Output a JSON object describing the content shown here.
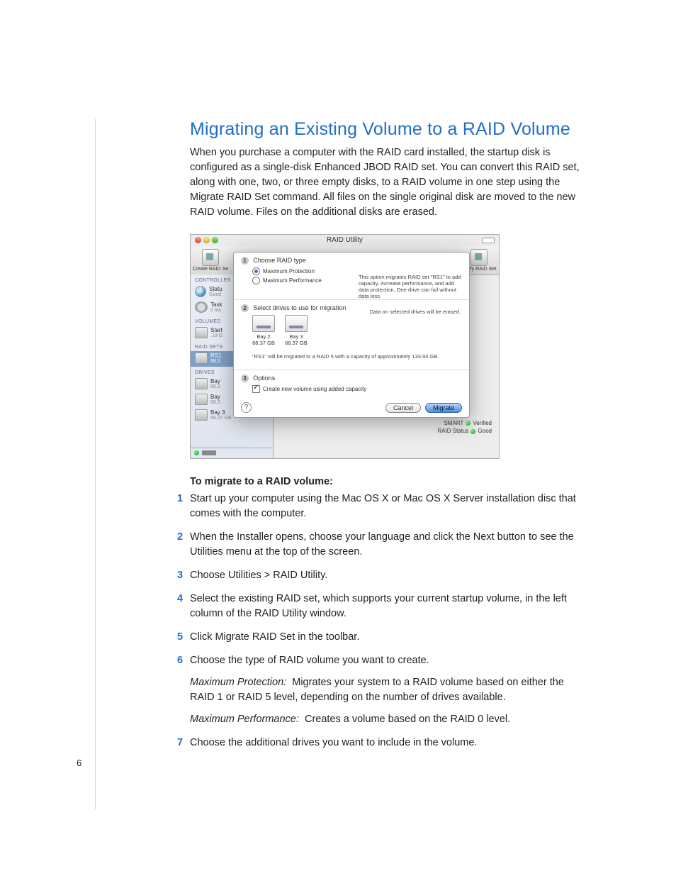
{
  "doc": {
    "title": "Migrating an Existing Volume to a RAID Volume",
    "intro": "When you purchase a computer with the RAID card installed, the startup disk is configured as a single-disk Enhanced JBOD RAID set. You can convert this RAID set, along with one, two, or three empty disks, to a RAID volume in one step using the Migrate RAID Set command. All files on the single original disk are moved to the new RAID volume. Files on the additional disks are erased.",
    "procedure_heading": "To migrate to a RAID volume:",
    "steps": [
      {
        "n": "1",
        "text": "Start up your computer using the Mac OS X or Mac OS X Server installation disc that comes with the computer."
      },
      {
        "n": "2",
        "text": "When the Installer opens, choose your language and click the Next button to see the Utilities menu at the top of the screen."
      },
      {
        "n": "3",
        "text": "Choose Utilities > RAID Utility."
      },
      {
        "n": "4",
        "text": "Select the existing RAID set, which supports your current startup volume, in the left column of the RAID Utility window."
      },
      {
        "n": "5",
        "text": "Click Migrate RAID Set in the toolbar."
      },
      {
        "n": "6",
        "text": "Choose the type of RAID volume you want to create.",
        "sub": [
          {
            "term": "Maximum Protection:",
            "desc": "Migrates your system to a RAID volume based on either the RAID 1 or RAID 5 level, depending on the number of drives available."
          },
          {
            "term": "Maximum Performance:",
            "desc": "Creates a volume based on the RAID 0 level."
          }
        ]
      },
      {
        "n": "7",
        "text": "Choose the additional drives you want to include in the volume."
      }
    ],
    "page_number": "6"
  },
  "screenshot": {
    "window_title": "RAID Utility",
    "toolbar": {
      "left_label": "Create RAID Se",
      "right_label": "Verify RAID Set"
    },
    "sidebar": {
      "h_controller": "CONTROLLER",
      "status_l1": "Statu",
      "status_l2": "Good",
      "tasks_l1": "Task",
      "tasks_l2": "0 tas",
      "h_volumes": "VOLUMES",
      "vol_l1": "Start",
      "vol_l2": ".19 G",
      "h_raidsets": "RAID SETS",
      "rs_l1": "RS1",
      "rs_l2": "68.3",
      "h_drives": "DRIVES",
      "d1_l1": "Bay",
      "d1_l2": "68.3",
      "d2_l1": "Bay",
      "d2_l2": "68.3",
      "d3_l1": "Bay 3",
      "d3_l2": "68.37 GB"
    },
    "sheet": {
      "step1": "Choose RAID type",
      "opt_protection": "Maximum Protection",
      "opt_performance": "Maximum Performance",
      "info": "This option migrates RAID set \"RS1\" to add capacity, increase performance, and add data protection. One drive can fail without data loss.",
      "step2": "Select drives to use for migration",
      "warn": "Data on selected drives will be erased.",
      "drive1_name": "Bay 2",
      "drive1_size": "68.37 GB",
      "drive2_name": "Bay 3",
      "drive2_size": "68.37 GB",
      "migrate_note": "\"RS1\" will be migrated to a RAID 5 with a capacity of approximately 133.94 GB.",
      "step3": "Options",
      "chk_label": "Create new volume using added capacity",
      "btn_cancel": "Cancel",
      "btn_migrate": "Migrate"
    },
    "below": {
      "smart_label": "SMART",
      "smart_value": "Verified",
      "raid_label": "RAID Status",
      "raid_value": "Good"
    }
  }
}
